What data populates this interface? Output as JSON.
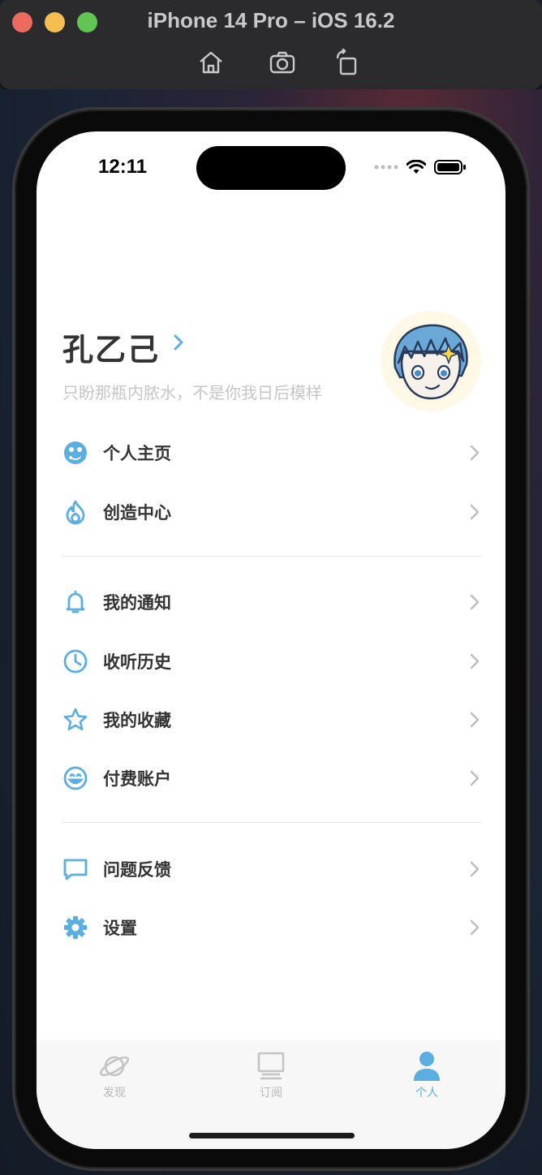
{
  "window": {
    "title": "iPhone 14 Pro – iOS 16.2",
    "toolbar": [
      "home-icon",
      "screenshot-icon",
      "rotate-icon"
    ]
  },
  "status_bar": {
    "time": "12:11"
  },
  "profile": {
    "name": "孔乙己",
    "bio": "只盼那瓶内脓水，不是你我日后模样"
  },
  "menu": {
    "group1": [
      {
        "label": "个人主页",
        "icon": "profile-page-icon"
      },
      {
        "label": "创造中心",
        "icon": "flame-icon"
      }
    ],
    "group2": [
      {
        "label": "我的通知",
        "icon": "bell-icon"
      },
      {
        "label": "收听历史",
        "icon": "clock-icon"
      },
      {
        "label": "我的收藏",
        "icon": "star-icon"
      },
      {
        "label": "付费账户",
        "icon": "smile-icon"
      }
    ],
    "group3": [
      {
        "label": "问题反馈",
        "icon": "message-icon"
      },
      {
        "label": "设置",
        "icon": "gear-icon"
      }
    ]
  },
  "tabs": [
    {
      "label": "发现",
      "icon": "planet-icon",
      "active": false
    },
    {
      "label": "订阅",
      "icon": "monitor-icon",
      "active": false
    },
    {
      "label": "个人",
      "icon": "person-icon",
      "active": true
    }
  ],
  "colors": {
    "accent": "#5aaee0",
    "text": "#333333",
    "muted": "#c6c6c6"
  }
}
